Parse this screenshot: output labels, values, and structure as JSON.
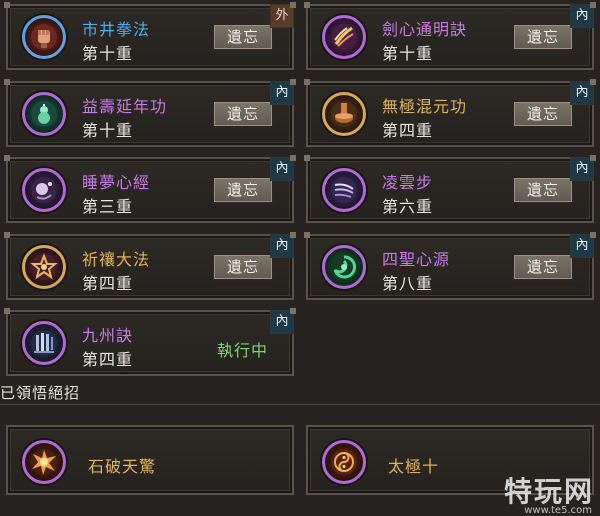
{
  "skills": [
    {
      "name": "市井拳法",
      "level": "第十重",
      "action": "遺忘",
      "type_tag": "外",
      "icon": "fist-icon"
    },
    {
      "name": "劍心通明訣",
      "level": "第十重",
      "action": "遺忘",
      "type_tag": "內",
      "icon": "sword-slash-icon"
    },
    {
      "name": "益壽延年功",
      "level": "第十重",
      "action": "遺忘",
      "type_tag": "內",
      "icon": "gourd-icon"
    },
    {
      "name": "無極混元功",
      "level": "第四重",
      "action": "遺忘",
      "type_tag": "內",
      "icon": "cauldron-icon"
    },
    {
      "name": "睡夢心經",
      "level": "第三重",
      "action": "遺忘",
      "type_tag": "內",
      "icon": "dream-icon"
    },
    {
      "name": "凌雲步",
      "level": "第六重",
      "action": "遺忘",
      "type_tag": "內",
      "icon": "wind-wing-icon"
    },
    {
      "name": "祈禳大法",
      "level": "第四重",
      "action": "遺忘",
      "type_tag": "內",
      "icon": "star-mandala-icon"
    },
    {
      "name": "四聖心源",
      "level": "第八重",
      "action": "遺忘",
      "type_tag": "內",
      "icon": "green-swirl-icon"
    },
    {
      "name": "九州訣",
      "level": "第四重",
      "action": "執行中",
      "type_tag": "內",
      "icon": "pillars-icon"
    }
  ],
  "section_title": "已領悟絕招",
  "ultimates": [
    {
      "name": "石破天驚",
      "icon": "rock-burst-icon"
    },
    {
      "name": "太極十",
      "icon": "taiji-icon"
    }
  ],
  "watermark": {
    "main": "特玩网",
    "sub": "www.te5.com"
  },
  "colors": {
    "blue_name": "#46b0ea",
    "purple_name": "#c87ae6",
    "gold_name": "#e3b454",
    "active_green": "#7ed86e"
  }
}
